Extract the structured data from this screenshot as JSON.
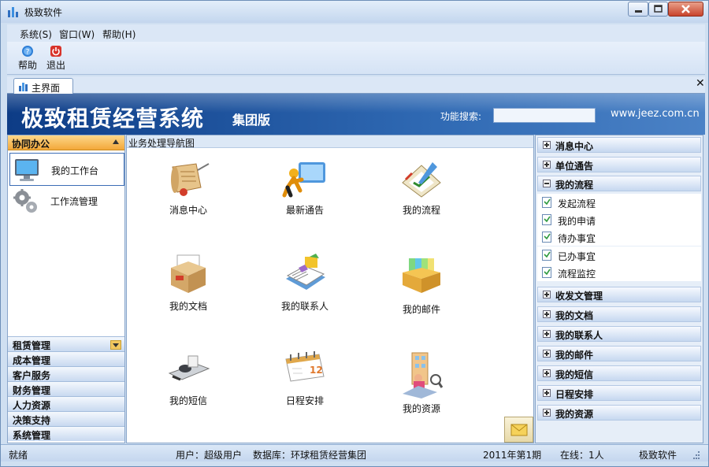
{
  "window": {
    "title": "极致软件"
  },
  "menu": [
    "系统(S)",
    "窗口(W)",
    "帮助(H)"
  ],
  "toolbar": {
    "help_label": "帮助",
    "exit_label": "退出"
  },
  "tab": {
    "label": "主界面"
  },
  "banner": {
    "title": "极致租赁经营系统",
    "edition": "集团版",
    "search_label": "功能搜索:",
    "search_value": "",
    "website": "www.jeez.com.cn"
  },
  "left": {
    "header": "协同办公",
    "items": [
      {
        "label": "我的工作台",
        "icon": "monitor-icon"
      },
      {
        "label": "工作流管理",
        "icon": "gears-icon"
      }
    ],
    "categories": [
      "租赁管理",
      "成本管理",
      "客户服务",
      "财务管理",
      "人力资源",
      "决策支持",
      "系统管理"
    ]
  },
  "center": {
    "title": "业务处理导航图",
    "items": [
      "消息中心",
      "最新通告",
      "我的流程",
      "我的文档",
      "我的联系人",
      "我的邮件",
      "我的短信",
      "日程安排",
      "我的资源"
    ]
  },
  "right": {
    "groups_top": [
      "消息中心",
      "单位通告",
      "我的流程"
    ],
    "sub_items": [
      "发起流程",
      "我的申请",
      "待办事宜",
      "已办事宜",
      "流程监控"
    ],
    "groups_bottom": [
      "收发文管理",
      "我的文档",
      "我的联系人",
      "我的邮件",
      "我的短信",
      "日程安排",
      "我的资源"
    ]
  },
  "status": {
    "ready": "就绪",
    "user": "用户：超级用户",
    "database": "数据库：环球租赁经营集团",
    "period": "2011年第1期",
    "online": "在线：1人",
    "vendor": "极致软件"
  }
}
